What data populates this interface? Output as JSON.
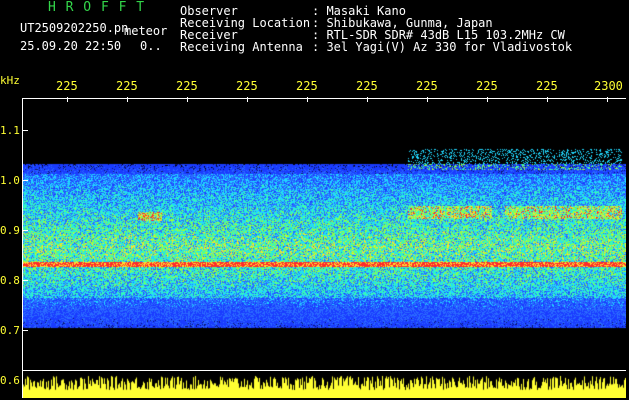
{
  "app": {
    "title": "H R O F F T"
  },
  "file": {
    "name": "UT2509202250.pn",
    "datetime": "25.09.20 22:50",
    "status": "0..",
    "mode": "meteor"
  },
  "header": {
    "labels": [
      "Observer",
      "Receiving Location",
      "Receiver",
      "Receiving Antenna"
    ],
    "values": [
      ": Masaki Kano",
      ": Shibukawa, Gunma, Japan",
      ": RTL-SDR SDR# 43dB L15 103.2MHz CW",
      ": 3el Yagi(V) Az 330 for Vladivostok"
    ]
  },
  "axes": {
    "y_unit": "kHz",
    "x_ticks": [
      "225",
      "225",
      "225",
      "225",
      "225",
      "225",
      "225",
      "225",
      "225",
      "2300"
    ],
    "y_ticks": [
      "1.1",
      "1.0",
      "0.9",
      "0.8",
      "0.7",
      "0.6"
    ]
  },
  "colors": {
    "background": "#000000",
    "title_green": "#33d64a",
    "axis_yellow": "#ffff33",
    "signal_red": "#ff2a2a",
    "noise_blue": "#1a3cff",
    "noise_cyan": "#20d8ff"
  }
}
